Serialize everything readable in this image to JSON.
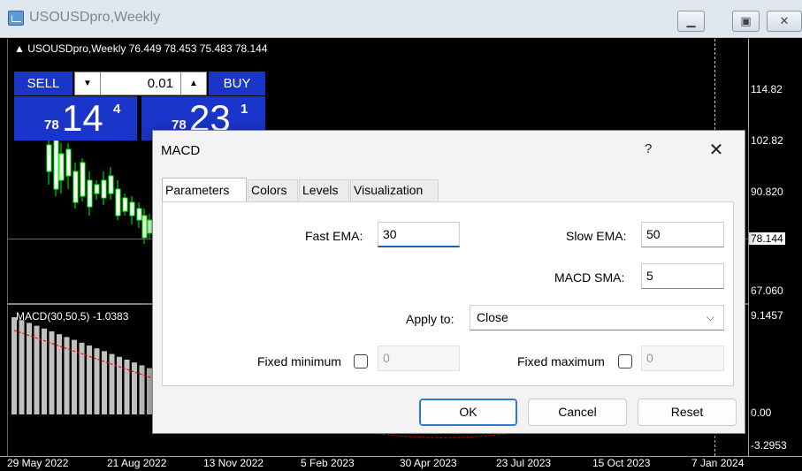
{
  "window": {
    "title": "USOUSDpro,Weekly",
    "min_icon": "minimize-icon",
    "max_icon": "maximize-icon",
    "close_icon": "close-icon"
  },
  "chart": {
    "info_line": "USOUSDpro,Weekly  76.449 78.453 75.483 78.144",
    "price_ticks": [
      "114.82",
      "102.82",
      "90.820",
      "78.144",
      "67.060",
      "9.1457",
      "0.00",
      "-3.2953"
    ],
    "current_price": "78.144",
    "time_ticks": [
      "29 May 2022",
      "21 Aug 2022",
      "13 Nov 2022",
      "5 Feb 2023",
      "30 Apr 2023",
      "23 Jul 2023",
      "15 Oct 2023",
      "7 Jan 2024"
    ],
    "macd_label": "MACD(30,50,5) -1.0383",
    "candle_color_up": "#ffffff",
    "candle_color_wick": "#00ff00",
    "histogram_color": "#c0c0c0",
    "signal_color": "#ff0000"
  },
  "trade_panel": {
    "sell_label": "SELL",
    "buy_label": "BUY",
    "lot_value": "0.01",
    "sell_small": "78",
    "sell_big": "14",
    "sell_sup": "4",
    "buy_small": "78",
    "buy_big": "23",
    "buy_sup": "1",
    "panel_color": "#1a35c9"
  },
  "dialog": {
    "title": "MACD",
    "help": "?",
    "close": "✕",
    "tabs": [
      "Parameters",
      "Colors",
      "Levels",
      "Visualization"
    ],
    "fast_ema_label": "Fast EMA:",
    "fast_ema_value": "30",
    "slow_ema_label": "Slow EMA:",
    "slow_ema_value": "50",
    "macd_sma_label": "MACD SMA:",
    "macd_sma_value": "5",
    "apply_to_label": "Apply to:",
    "apply_to_value": "Close",
    "fixed_min_label": "Fixed minimum",
    "fixed_min_value": "0",
    "fixed_max_label": "Fixed maximum",
    "fixed_max_value": "0",
    "ok_label": "OK",
    "cancel_label": "Cancel",
    "reset_label": "Reset"
  }
}
